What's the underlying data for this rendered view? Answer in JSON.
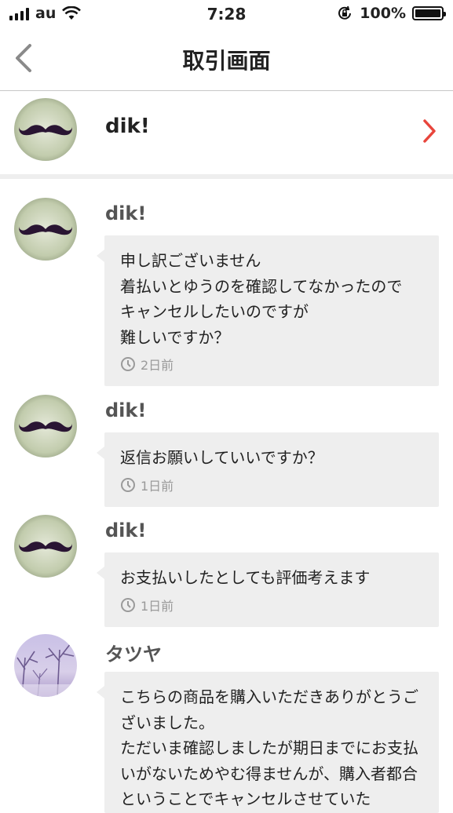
{
  "status_bar": {
    "carrier": "au",
    "time": "7:28",
    "battery": "100%"
  },
  "navbar": {
    "title": "取引画面"
  },
  "partner": {
    "name": "dik!"
  },
  "messages": [
    {
      "name": "dik!",
      "text": "申し訳ございません\n着払いとゆうのを確認してなかったので\nキャンセルしたいのですが\n難しいですか？",
      "time": "2日前"
    },
    {
      "name": "dik!",
      "text": "返信お願いしていいですか？",
      "time": "1日前"
    },
    {
      "name": "dik!",
      "text": "お支払いしたとしても評価考えます",
      "time": "1日前"
    },
    {
      "name": "タツヤ",
      "text": "こちらの商品を購入いただきありがとうございました。\nただいま確認しましたが期日までにお支払いがないためやむ得ませんが、購入者都合ということでキャンセルさせていた",
      "time": ""
    }
  ],
  "colors": {
    "accent": "#e8453c",
    "bubble": "#eeeeee",
    "divider": "#c8c8c8"
  }
}
